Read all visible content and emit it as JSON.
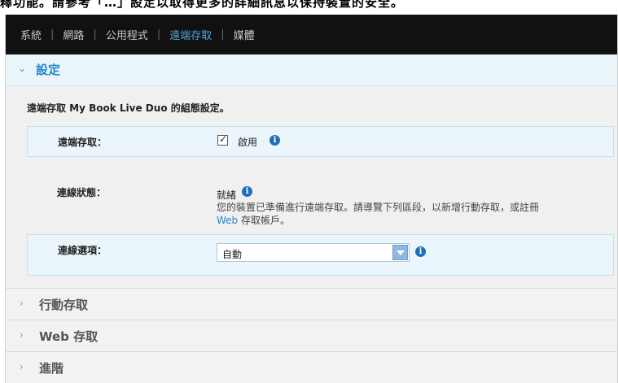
{
  "top_strip_text": "釋功能。請參考「…」設定以取得更多的詳細訊息以保持裝置的安全。",
  "nav": {
    "items": [
      "系統",
      "網路",
      "公用程式",
      "遠端存取",
      "媒體"
    ],
    "active_index": 3,
    "separator": "|"
  },
  "settings": {
    "title": "設定",
    "description": "遠端存取 My Book Live Duo 的組態設定。",
    "remote_access": {
      "label": "遠端存取：",
      "checkbox_checked": true,
      "value": "啟用"
    },
    "connection_status": {
      "label": "連線狀態：",
      "value": "就緒",
      "message_line1": "您的裝置已準備進行遠端存取。請導覽下列區段，以新增行動存取，或註冊",
      "message_web": "Web",
      "message_line2": " 存取帳戶。"
    },
    "connection_option": {
      "label": "連線選項：",
      "selected": "自動"
    }
  },
  "sections": {
    "mobile_access": "行動存取",
    "web_access": "Web 存取",
    "advanced": "進階"
  },
  "icons": {
    "info": "i",
    "expanded": "⌄",
    "collapsed": "›"
  },
  "colors": {
    "nav_bg": "#111111",
    "nav_active": "#56a6d8",
    "section_title": "#1f87c4",
    "info_icon": "#1f6fb8"
  }
}
